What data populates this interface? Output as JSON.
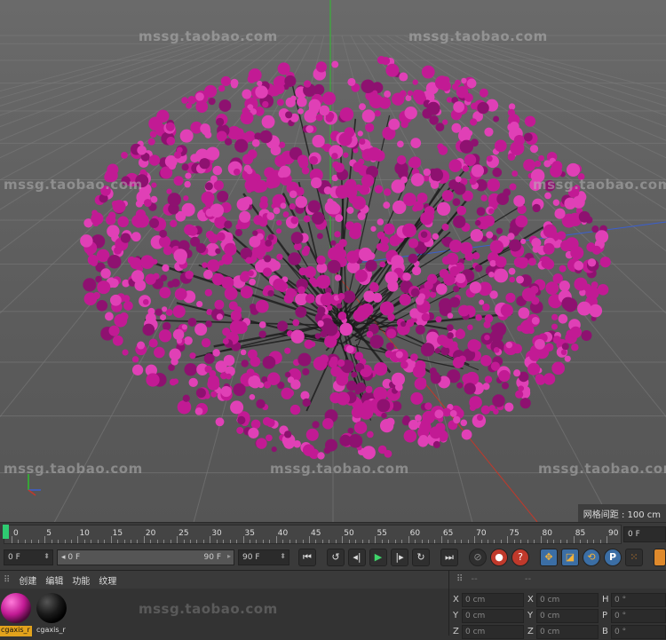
{
  "viewport": {
    "watermark": "mssg.taobao.com",
    "grid_spacing": "网格间距 : 100 cm",
    "object_color": "#c21a94"
  },
  "timeline": {
    "ticks": [
      "0",
      "5",
      "10",
      "15",
      "20",
      "25",
      "30",
      "35",
      "40",
      "45",
      "50",
      "55",
      "60",
      "65",
      "70",
      "75",
      "80",
      "85",
      "90"
    ],
    "current_frame": "0 F"
  },
  "controls": {
    "start_frame": "0 F",
    "range_start": "0 F",
    "range_end": "90 F",
    "end_frame": "90 F",
    "playback_icons": [
      "first-frame-icon",
      "previous-key-icon",
      "previous-frame-icon",
      "play-icon",
      "next-frame-icon",
      "next-key-icon",
      "last-frame-icon"
    ],
    "tool_labels": {
      "param": "P"
    }
  },
  "material_panel": {
    "menu": [
      "创建",
      "编辑",
      "功能",
      "纹理"
    ],
    "materials": [
      {
        "label": "cgaxis_r",
        "color": "#d0259a",
        "selected": true
      },
      {
        "label": "cgaxis_r",
        "color": "#1a1a1a",
        "selected": false
      }
    ]
  },
  "coordinates": {
    "header": [
      "--",
      "--"
    ],
    "rows": [
      {
        "axis": "X",
        "pos": "0 cm",
        "size_axis": "X",
        "size": "0 cm",
        "rot_axis": "H",
        "rot": "0 °"
      },
      {
        "axis": "Y",
        "pos": "0 cm",
        "size_axis": "Y",
        "size": "0 cm",
        "rot_axis": "P",
        "rot": "0 °"
      },
      {
        "axis": "Z",
        "pos": "0 cm",
        "size_axis": "Z",
        "size": "0 cm",
        "rot_axis": "B",
        "rot": "0 °"
      }
    ]
  }
}
